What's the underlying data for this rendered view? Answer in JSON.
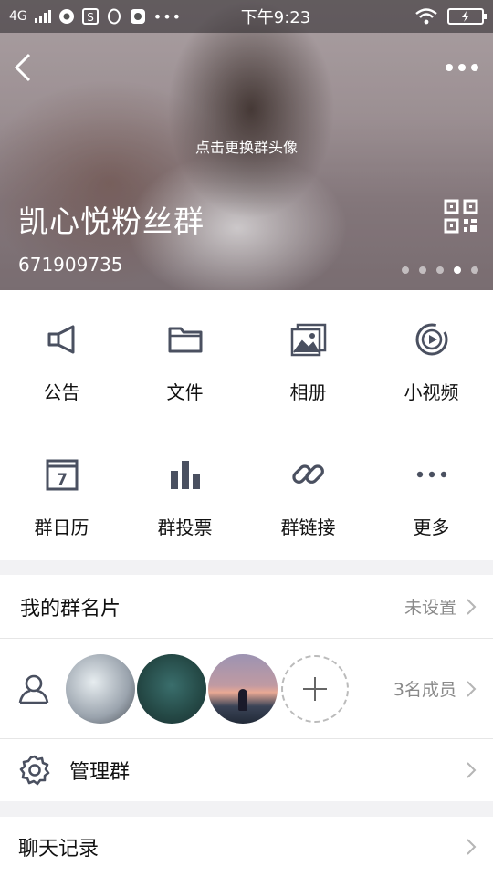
{
  "status_bar": {
    "network": "4G",
    "time": "下午9:23"
  },
  "header": {
    "change_avatar_hint": "点击更换群头像",
    "group_name": "凯心悦粉丝群",
    "group_id": "671909735",
    "page_dots": 5,
    "active_dot": 4
  },
  "grid": {
    "items": [
      {
        "label": "公告",
        "icon": "megaphone-icon"
      },
      {
        "label": "文件",
        "icon": "folder-icon"
      },
      {
        "label": "相册",
        "icon": "album-icon"
      },
      {
        "label": "小视频",
        "icon": "video-icon"
      },
      {
        "label": "群日历",
        "icon": "calendar-icon"
      },
      {
        "label": "群投票",
        "icon": "vote-chart-icon"
      },
      {
        "label": "群链接",
        "icon": "link-icon"
      },
      {
        "label": "更多",
        "icon": "more-dots-icon"
      }
    ],
    "calendar_day": "7"
  },
  "card": {
    "title": "我的群名片",
    "value": "未设置"
  },
  "members": {
    "count_text": "3名成员"
  },
  "manage": {
    "title": "管理群"
  },
  "history": {
    "title": "聊天记录"
  },
  "colors": {
    "icon_gray": "#4a5060",
    "text_dark": "#111111",
    "text_light": "#8a8a8a"
  }
}
